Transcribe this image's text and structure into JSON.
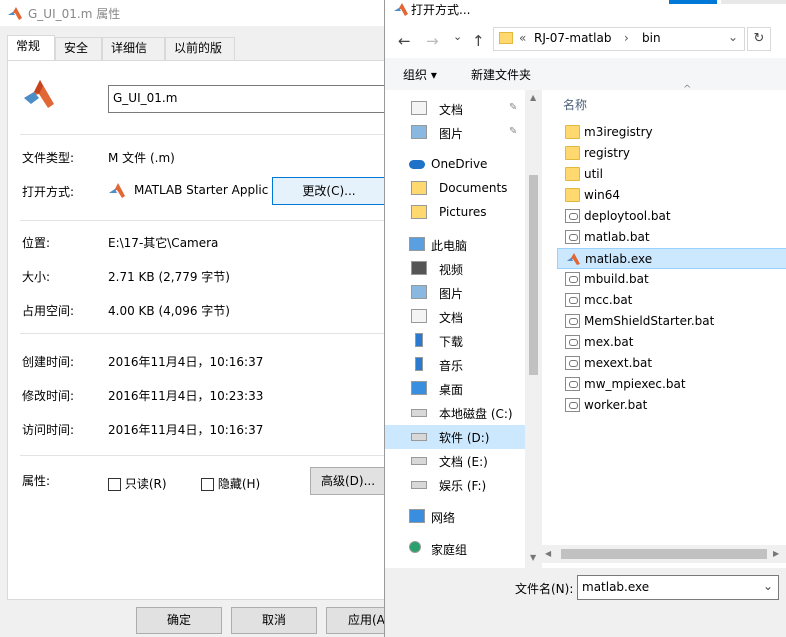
{
  "properties": {
    "window_title": "G_UI_01.m 属性",
    "tabs": [
      "常规",
      "安全",
      "详细信息",
      "以前的版本"
    ],
    "filename": "G_UI_01.m",
    "rows": {
      "type_label": "文件类型:",
      "type_value": "M 文件 (.m)",
      "openwith_label": "打开方式:",
      "openwith_value": "MATLAB Starter Applic",
      "change_button": "更改(C)...",
      "location_label": "位置:",
      "location_value": "E:\\17-其它\\Camera",
      "size_label": "大小:",
      "size_value": "2.71 KB (2,779 字节)",
      "disk_label": "占用空间:",
      "disk_value": "4.00 KB (4,096 字节)",
      "created_label": "创建时间:",
      "created_value": "2016年11月4日，10:16:37",
      "modified_label": "修改时间:",
      "modified_value": "2016年11月4日，10:23:33",
      "accessed_label": "访问时间:",
      "accessed_value": "2016年11月4日，10:16:37",
      "attr_label": "属性:",
      "readonly_label": "只读(R)",
      "hidden_label": "隐藏(H)",
      "advanced_button": "高级(D)..."
    },
    "footer": {
      "ok": "确定",
      "cancel": "取消",
      "apply": "应用(A"
    }
  },
  "open_dialog": {
    "window_title": "打开方式...",
    "breadcrumb": {
      "chevrons": "«",
      "parts": [
        "RJ-07-matlab",
        "bin"
      ],
      "sep": "›"
    },
    "toolbar": {
      "organize": "组织 ▾",
      "new_folder": "新建文件夹"
    },
    "column_name": "名称",
    "nav_items": [
      {
        "label": "文档",
        "icon": "document-icon",
        "pinned": true
      },
      {
        "label": "图片",
        "icon": "picture-icon",
        "pinned": true
      },
      {
        "label": "OneDrive",
        "icon": "onedrive-icon"
      },
      {
        "label": "Documents",
        "icon": "folder-icon"
      },
      {
        "label": "Pictures",
        "icon": "folder-icon"
      },
      {
        "label": "此电脑",
        "icon": "computer-icon"
      },
      {
        "label": "视频",
        "icon": "video-icon"
      },
      {
        "label": "图片",
        "icon": "picture-icon"
      },
      {
        "label": "文档",
        "icon": "document-icon"
      },
      {
        "label": "下载",
        "icon": "download-icon"
      },
      {
        "label": "音乐",
        "icon": "music-icon"
      },
      {
        "label": "桌面",
        "icon": "desktop-icon"
      },
      {
        "label": "本地磁盘 (C:)",
        "icon": "drive-icon"
      },
      {
        "label": "软件 (D:)",
        "icon": "drive-icon",
        "selected": true
      },
      {
        "label": "文档 (E:)",
        "icon": "drive-icon"
      },
      {
        "label": "娱乐 (F:)",
        "icon": "drive-icon"
      },
      {
        "label": "网络",
        "icon": "network-icon"
      },
      {
        "label": "家庭组",
        "icon": "homegroup-icon"
      }
    ],
    "files": [
      {
        "name": "m3iregistry",
        "kind": "folder"
      },
      {
        "name": "registry",
        "kind": "folder"
      },
      {
        "name": "util",
        "kind": "folder"
      },
      {
        "name": "win64",
        "kind": "folder"
      },
      {
        "name": "deploytool.bat",
        "kind": "bat"
      },
      {
        "name": "matlab.bat",
        "kind": "bat"
      },
      {
        "name": "matlab.exe",
        "kind": "exe",
        "selected": true
      },
      {
        "name": "mbuild.bat",
        "kind": "bat"
      },
      {
        "name": "mcc.bat",
        "kind": "bat"
      },
      {
        "name": "MemShieldStarter.bat",
        "kind": "bat"
      },
      {
        "name": "mex.bat",
        "kind": "bat"
      },
      {
        "name": "mexext.bat",
        "kind": "bat"
      },
      {
        "name": "mw_mpiexec.bat",
        "kind": "bat"
      },
      {
        "name": "worker.bat",
        "kind": "bat"
      }
    ],
    "filename_label": "文件名(N):",
    "filename_value": "matlab.exe"
  },
  "colors": {
    "accent": "#0078d7",
    "selection": "#cce8ff",
    "matlab_orange": "#e16737"
  }
}
